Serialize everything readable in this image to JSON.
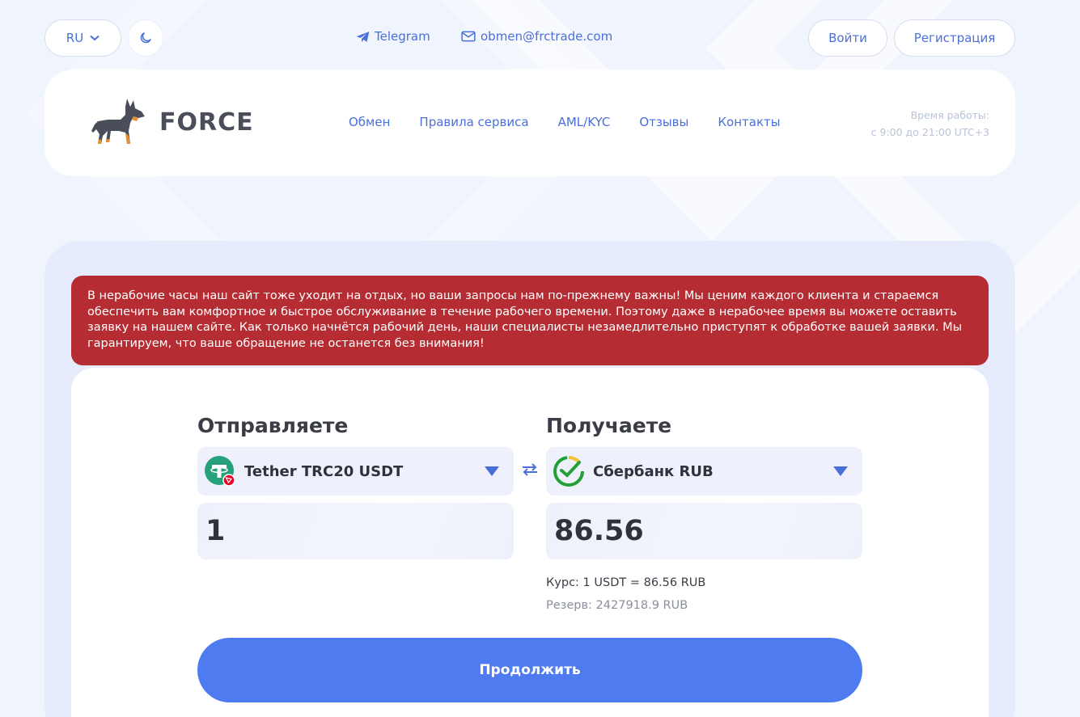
{
  "topbar": {
    "lang": "RU",
    "telegram": "Telegram",
    "email": "obmen@frctrade.com",
    "login": "Войти",
    "register": "Регистрация"
  },
  "header": {
    "logo_text": "FORCE",
    "nav": [
      "Обмен",
      "Правила сервиса",
      "AML/KYC",
      "Отзывы",
      "Контакты"
    ],
    "hours_label": "Время работы:",
    "hours_value": "с 9:00 до 21:00 UTC+3"
  },
  "alert": {
    "text": "В нерабочие часы наш сайт тоже уходит на отдых, но ваши запросы нам по-прежнему важны! Мы ценим каждого клиента и стараемся обеспечить вам комфортное и быстрое обслуживание в течение рабочего времени. Поэтому даже в нерабочее время вы можете оставить заявку на нашем сайте. Как только начнётся рабочий день, наши специалисты незамедлительно приступят к обработке вашей заявки. Мы гарантируем, что ваше обращение не останется без внимания!"
  },
  "exchange": {
    "send_title": "Отправляете",
    "receive_title": "Получаете",
    "send_currency": "Tether TRC20 USDT",
    "receive_currency": "Сбербанк RUB",
    "send_amount": "1",
    "receive_amount": "86.56",
    "rate": "Курс: 1 USDT = 86.56 RUB",
    "reserve": "Резерв: 2427918.9 RUB",
    "continue": "Продолжить"
  },
  "colors": {
    "accent": "#4e7cf0",
    "link": "#4a6fd8",
    "alert": "#b52c32",
    "tether": "#26a17b",
    "sber": "#21a038"
  }
}
